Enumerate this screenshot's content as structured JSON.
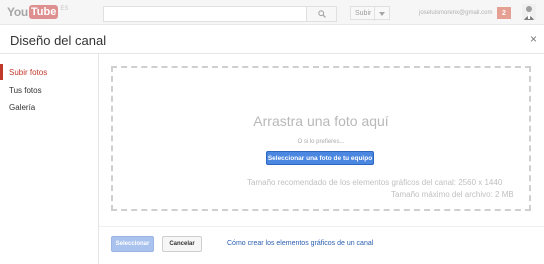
{
  "masthead": {
    "logo_you": "You",
    "logo_tube": "Tube",
    "logo_locale": "ES",
    "upload_label": "Subir",
    "email": "joseluismorenx@gmail.com",
    "notification_count": "2"
  },
  "dialog": {
    "title": "Diseño del canal",
    "close_label": "×"
  },
  "sidebar": {
    "items": [
      {
        "label": "Subir fotos",
        "active": true
      },
      {
        "label": "Tus fotos",
        "active": false
      },
      {
        "label": "Galería",
        "active": false
      }
    ]
  },
  "dropzone": {
    "heading": "Arrastra una foto aquí",
    "or_text": "O si lo prefieres...",
    "select_button": "Seleccionar una foto de tu equipo",
    "size_hint": "Tamaño recomendado de los elementos gráficos del canal: 2560 x 1440",
    "max_size_hint": "Tamaño máximo del archivo: 2 MB"
  },
  "footer": {
    "select_label": "Seleccionar",
    "cancel_label": "Cancelar",
    "help_link": "Cómo crear los elementos gráficos de un canal"
  },
  "icons": {
    "search": "search-icon",
    "caret": "chevron-down-icon",
    "close": "close-icon",
    "avatar": "avatar"
  },
  "colors": {
    "accent_red": "#c0392b",
    "primary_blue": "#4b86e0",
    "disabled_blue": "#a9c3ee",
    "link_blue": "#2a5db0"
  }
}
